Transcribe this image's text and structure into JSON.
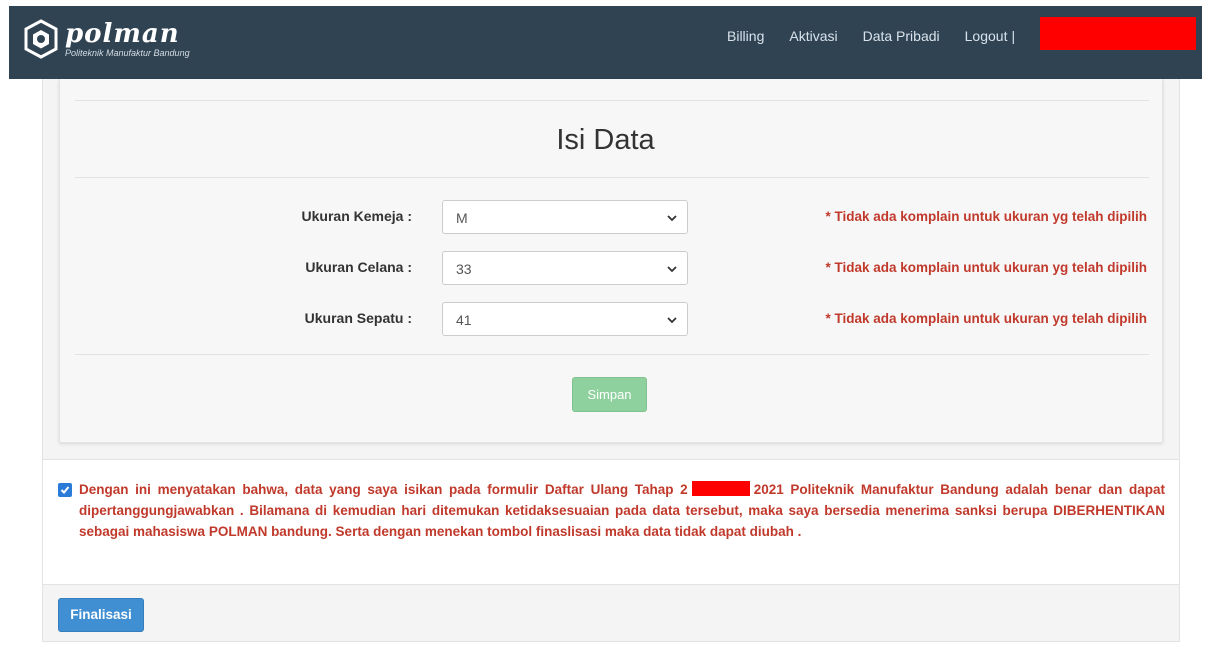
{
  "brand": {
    "name": "polman",
    "subtitle": "Politeknik Manufaktur Bandung"
  },
  "nav": {
    "items": [
      "Billing",
      "Aktivasi",
      "Data Pribadi"
    ],
    "logout": "Logout",
    "separator": "|"
  },
  "form": {
    "title": "Isi Data",
    "fields": [
      {
        "label": "Ukuran Kemeja :",
        "value": "M",
        "note": "* Tidak ada komplain untuk ukuran yg telah dipilih"
      },
      {
        "label": "Ukuran Celana :",
        "value": "33",
        "note": "* Tidak ada komplain untuk ukuran yg telah dipilih"
      },
      {
        "label": "Ukuran Sepatu :",
        "value": "41",
        "note": "* Tidak ada komplain untuk ukuran yg telah dipilih"
      }
    ],
    "save_label": "Simpan"
  },
  "statement": {
    "checked": true,
    "part1": "Dengan ini menyatakan bahwa, data yang saya isikan pada formulir Daftar Ulang Tahap 2",
    "part2": "2021 Politeknik Manufaktur Bandung adalah benar dan dapat dipertanggungjawabkan . Bilamana di kemudian hari ditemukan ketidaksesuaian pada data tersebut, maka saya bersedia menerima sanksi berupa DIBERHENTIKAN sebagai mahasiswa POLMAN bandung. Serta dengan menekan tombol finaslisasi maka data tidak dapat diubah ."
  },
  "finalize_label": "Finalisasi",
  "colors": {
    "navbar": "#2f4353",
    "note_red": "#c0392b",
    "simpan_green": "#8fd19e",
    "finalisasi_blue": "#3f8fd2",
    "redaction": "#ff0000"
  },
  "icons": {
    "logo": "polman-logo-icon",
    "select_arrow": "chevron-down-icon",
    "checkbox": "checkmark-icon"
  }
}
